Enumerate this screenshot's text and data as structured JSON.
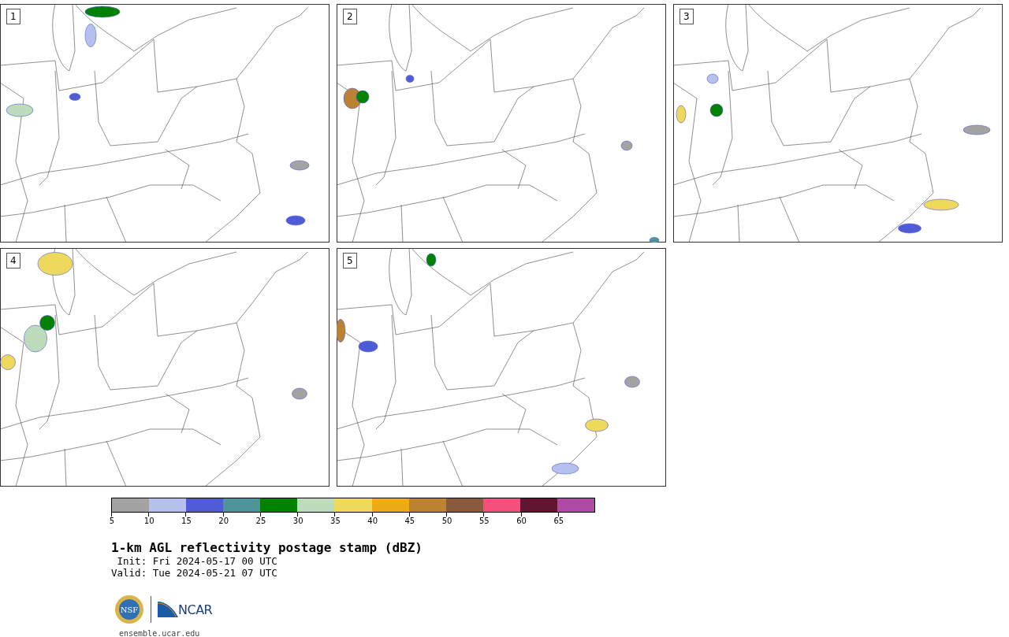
{
  "panels": [
    {
      "number": "1"
    },
    {
      "number": "2"
    },
    {
      "number": "3"
    },
    {
      "number": "4"
    },
    {
      "number": "5"
    }
  ],
  "colorbar": {
    "segments": [
      {
        "color": "#a3a3a3"
      },
      {
        "color": "#b5c0ec"
      },
      {
        "color": "#505cd6"
      },
      {
        "color": "#4e949a"
      },
      {
        "color": "#028102"
      },
      {
        "color": "#bddcbb"
      },
      {
        "color": "#efd95c"
      },
      {
        "color": "#efab16"
      },
      {
        "color": "#bb8232"
      },
      {
        "color": "#8a5a3f"
      },
      {
        "color": "#f54f7c"
      },
      {
        "color": "#611532"
      },
      {
        "color": "#ae4aa5"
      }
    ],
    "ticks": [
      "5",
      "10",
      "15",
      "20",
      "25",
      "30",
      "35",
      "40",
      "45",
      "50",
      "55",
      "60",
      "65"
    ]
  },
  "title": "1-km AGL reflectivity postage stamp (dBZ)",
  "init": " Init: Fri 2024-05-17 00 UTC",
  "valid": "Valid: Tue 2024-05-21 07 UTC",
  "logos": {
    "nsf": "NSF",
    "ncar": "NCAR"
  },
  "footer": "ensemble.ucar.edu"
}
